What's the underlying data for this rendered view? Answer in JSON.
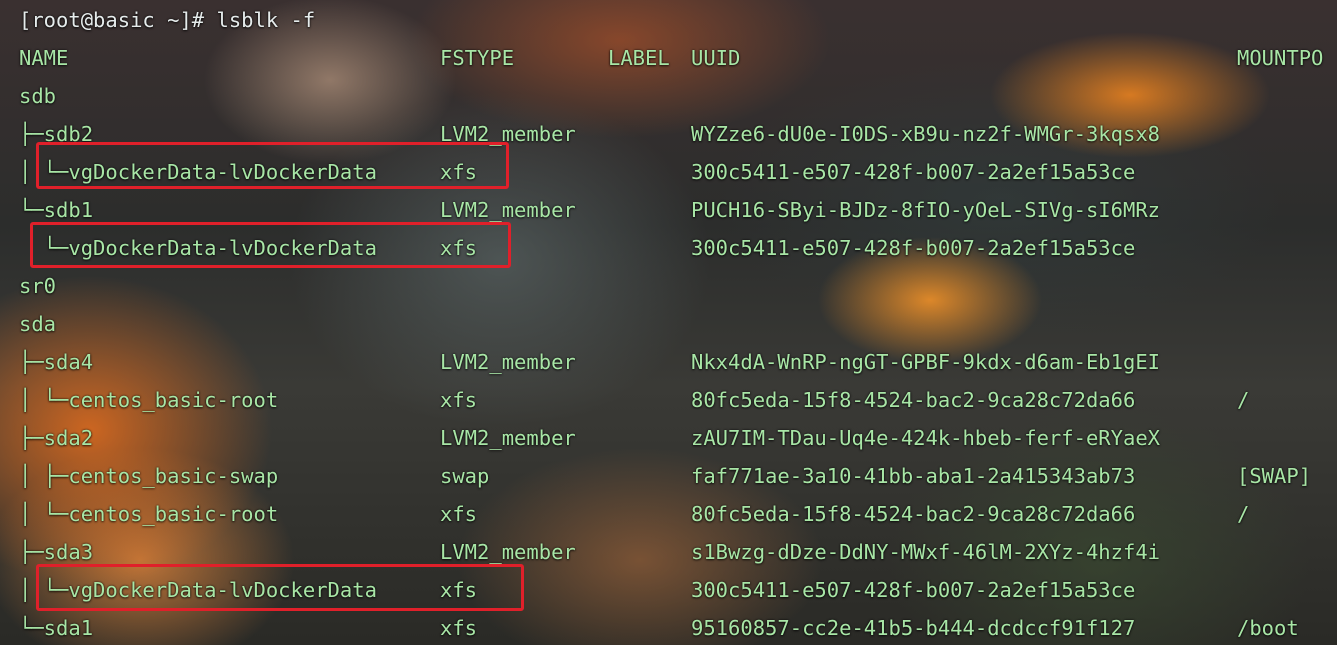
{
  "terminal": {
    "prompt": "[root@basic ~]# lsblk -f",
    "headers": {
      "name": "NAME",
      "fstype": "FSTYPE",
      "label": "LABEL",
      "uuid": "UUID",
      "mountpoint": "MOUNTPO"
    },
    "rows": [
      {
        "name": "sdb",
        "fstype": "",
        "uuid": "",
        "mount": ""
      },
      {
        "name": "├─sdb2",
        "fstype": "LVM2_member",
        "uuid": "WYZze6-dU0e-I0DS-xB9u-nz2f-WMGr-3kqsx8",
        "mount": ""
      },
      {
        "name": "│ └─vgDockerData-lvDockerData",
        "fstype": "xfs",
        "uuid": "300c5411-e507-428f-b007-2a2ef15a53ce",
        "mount": ""
      },
      {
        "name": "└─sdb1",
        "fstype": "LVM2_member",
        "uuid": "PUCH16-SByi-BJDz-8fIO-yOeL-SIVg-sI6MRz",
        "mount": ""
      },
      {
        "name": "  └─vgDockerData-lvDockerData",
        "fstype": "xfs",
        "uuid": "300c5411-e507-428f-b007-2a2ef15a53ce",
        "mount": ""
      },
      {
        "name": "sr0",
        "fstype": "",
        "uuid": "",
        "mount": ""
      },
      {
        "name": "sda",
        "fstype": "",
        "uuid": "",
        "mount": ""
      },
      {
        "name": "├─sda4",
        "fstype": "LVM2_member",
        "uuid": "Nkx4dA-WnRP-ngGT-GPBF-9kdx-d6am-Eb1gEI",
        "mount": ""
      },
      {
        "name": "│ └─centos_basic-root",
        "fstype": "xfs",
        "uuid": "80fc5eda-15f8-4524-bac2-9ca28c72da66",
        "mount": "/"
      },
      {
        "name": "├─sda2",
        "fstype": "LVM2_member",
        "uuid": "zAU7IM-TDau-Uq4e-424k-hbeb-ferf-eRYaeX",
        "mount": ""
      },
      {
        "name": "│ ├─centos_basic-swap",
        "fstype": "swap",
        "uuid": "faf771ae-3a10-41bb-aba1-2a415343ab73",
        "mount": "[SWAP]"
      },
      {
        "name": "│ └─centos_basic-root",
        "fstype": "xfs",
        "uuid": "80fc5eda-15f8-4524-bac2-9ca28c72da66",
        "mount": "/"
      },
      {
        "name": "├─sda3",
        "fstype": "LVM2_member",
        "uuid": "s1Bwzg-dDze-DdNY-MWxf-46lM-2XYz-4hzf4i",
        "mount": ""
      },
      {
        "name": "│ └─vgDockerData-lvDockerData",
        "fstype": "xfs",
        "uuid": "300c5411-e507-428f-b007-2a2ef15a53ce",
        "mount": ""
      },
      {
        "name": "└─sda1",
        "fstype": "xfs",
        "uuid": "95160857-cc2e-41b5-b444-dcdccf91f127",
        "mount": "/boot"
      }
    ]
  },
  "colors": {
    "text": "#a8e6a6",
    "prompt": "#e6ecec",
    "highlight": "#e0202a"
  }
}
